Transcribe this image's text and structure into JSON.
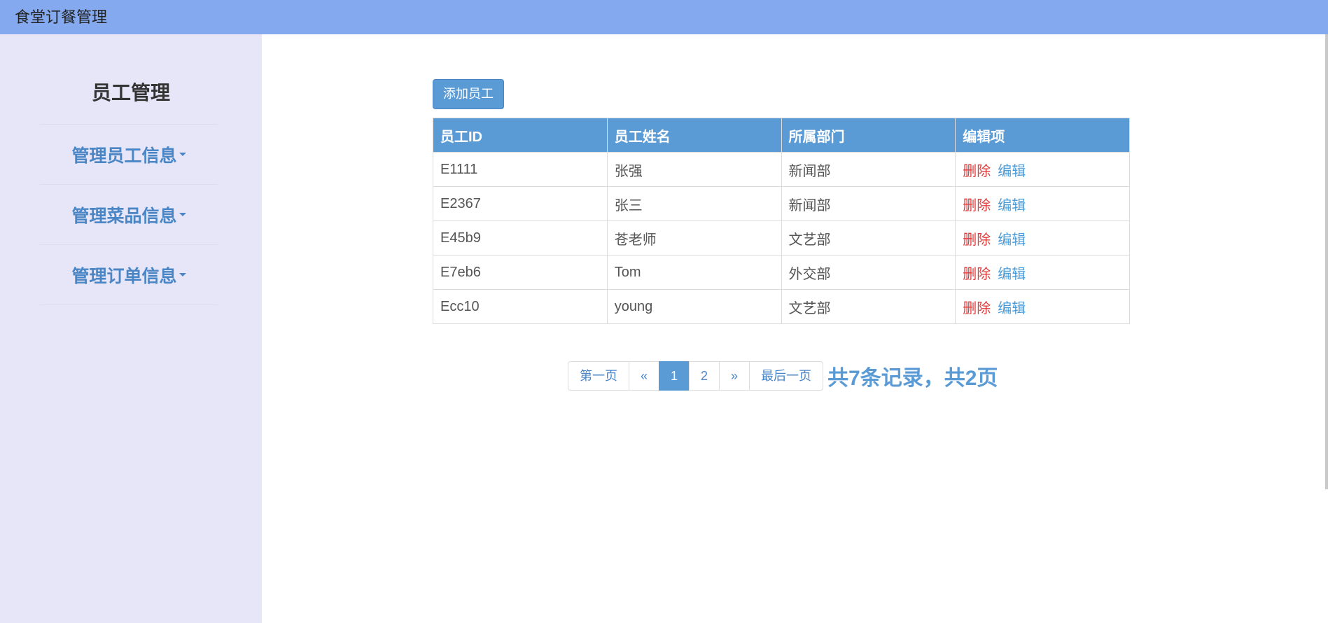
{
  "app": {
    "title": "食堂订餐管理"
  },
  "sidebar": {
    "title": "员工管理",
    "items": [
      {
        "label": "管理员工信息"
      },
      {
        "label": "管理菜品信息"
      },
      {
        "label": "管理订单信息"
      }
    ]
  },
  "toolbar": {
    "add_label": "添加员工"
  },
  "table": {
    "headers": [
      "员工ID",
      "员工姓名",
      "所属部门",
      "编辑项"
    ],
    "delete_label": "删除",
    "edit_label": "编辑",
    "rows": [
      {
        "id": "E1111",
        "name": "张强",
        "dept": "新闻部"
      },
      {
        "id": "E2367",
        "name": "张三",
        "dept": "新闻部"
      },
      {
        "id": "E45b9",
        "name": "苍老师",
        "dept": "文艺部"
      },
      {
        "id": "E7eb6",
        "name": "Tom",
        "dept": "外交部"
      },
      {
        "id": "Ecc10",
        "name": "young",
        "dept": "文艺部"
      }
    ]
  },
  "pagination": {
    "first_label": "第一页",
    "prev_label": "«",
    "pages": [
      "1",
      "2"
    ],
    "current_page": "1",
    "next_label": "»",
    "last_label": "最后一页",
    "summary": "共7条记录，共2页"
  },
  "colors": {
    "topbar": "#84a9ee",
    "sidebar": "#e6e6f8",
    "accent": "#5b9bd5",
    "danger": "#e03a3a"
  }
}
